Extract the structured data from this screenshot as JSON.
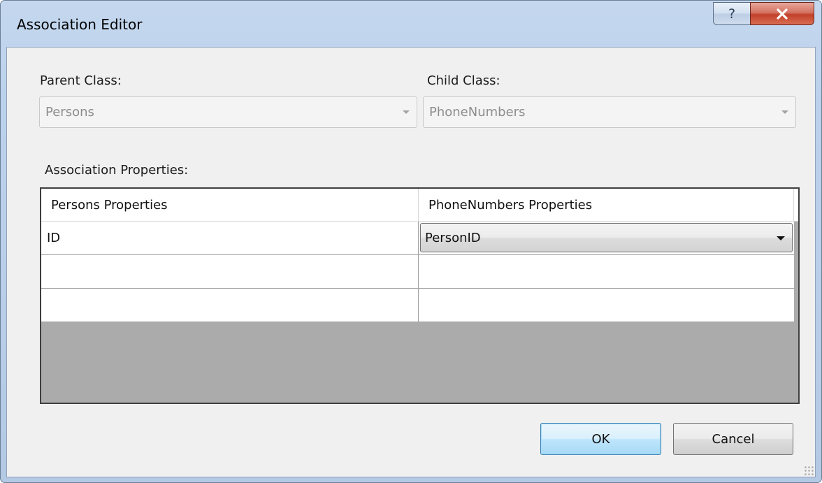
{
  "window": {
    "title": "Association Editor",
    "help_label": "?"
  },
  "parent": {
    "label": "Parent Class:",
    "value": "Persons"
  },
  "child": {
    "label": "Child Class:",
    "value": "PhoneNumbers"
  },
  "association": {
    "label": "Association Properties:",
    "columns": [
      "Persons Properties",
      "PhoneNumbers Properties"
    ],
    "rows": [
      [
        "ID",
        "PersonID"
      ],
      [
        "",
        ""
      ],
      [
        "",
        ""
      ]
    ]
  },
  "buttons": {
    "ok": "OK",
    "cancel": "Cancel"
  }
}
